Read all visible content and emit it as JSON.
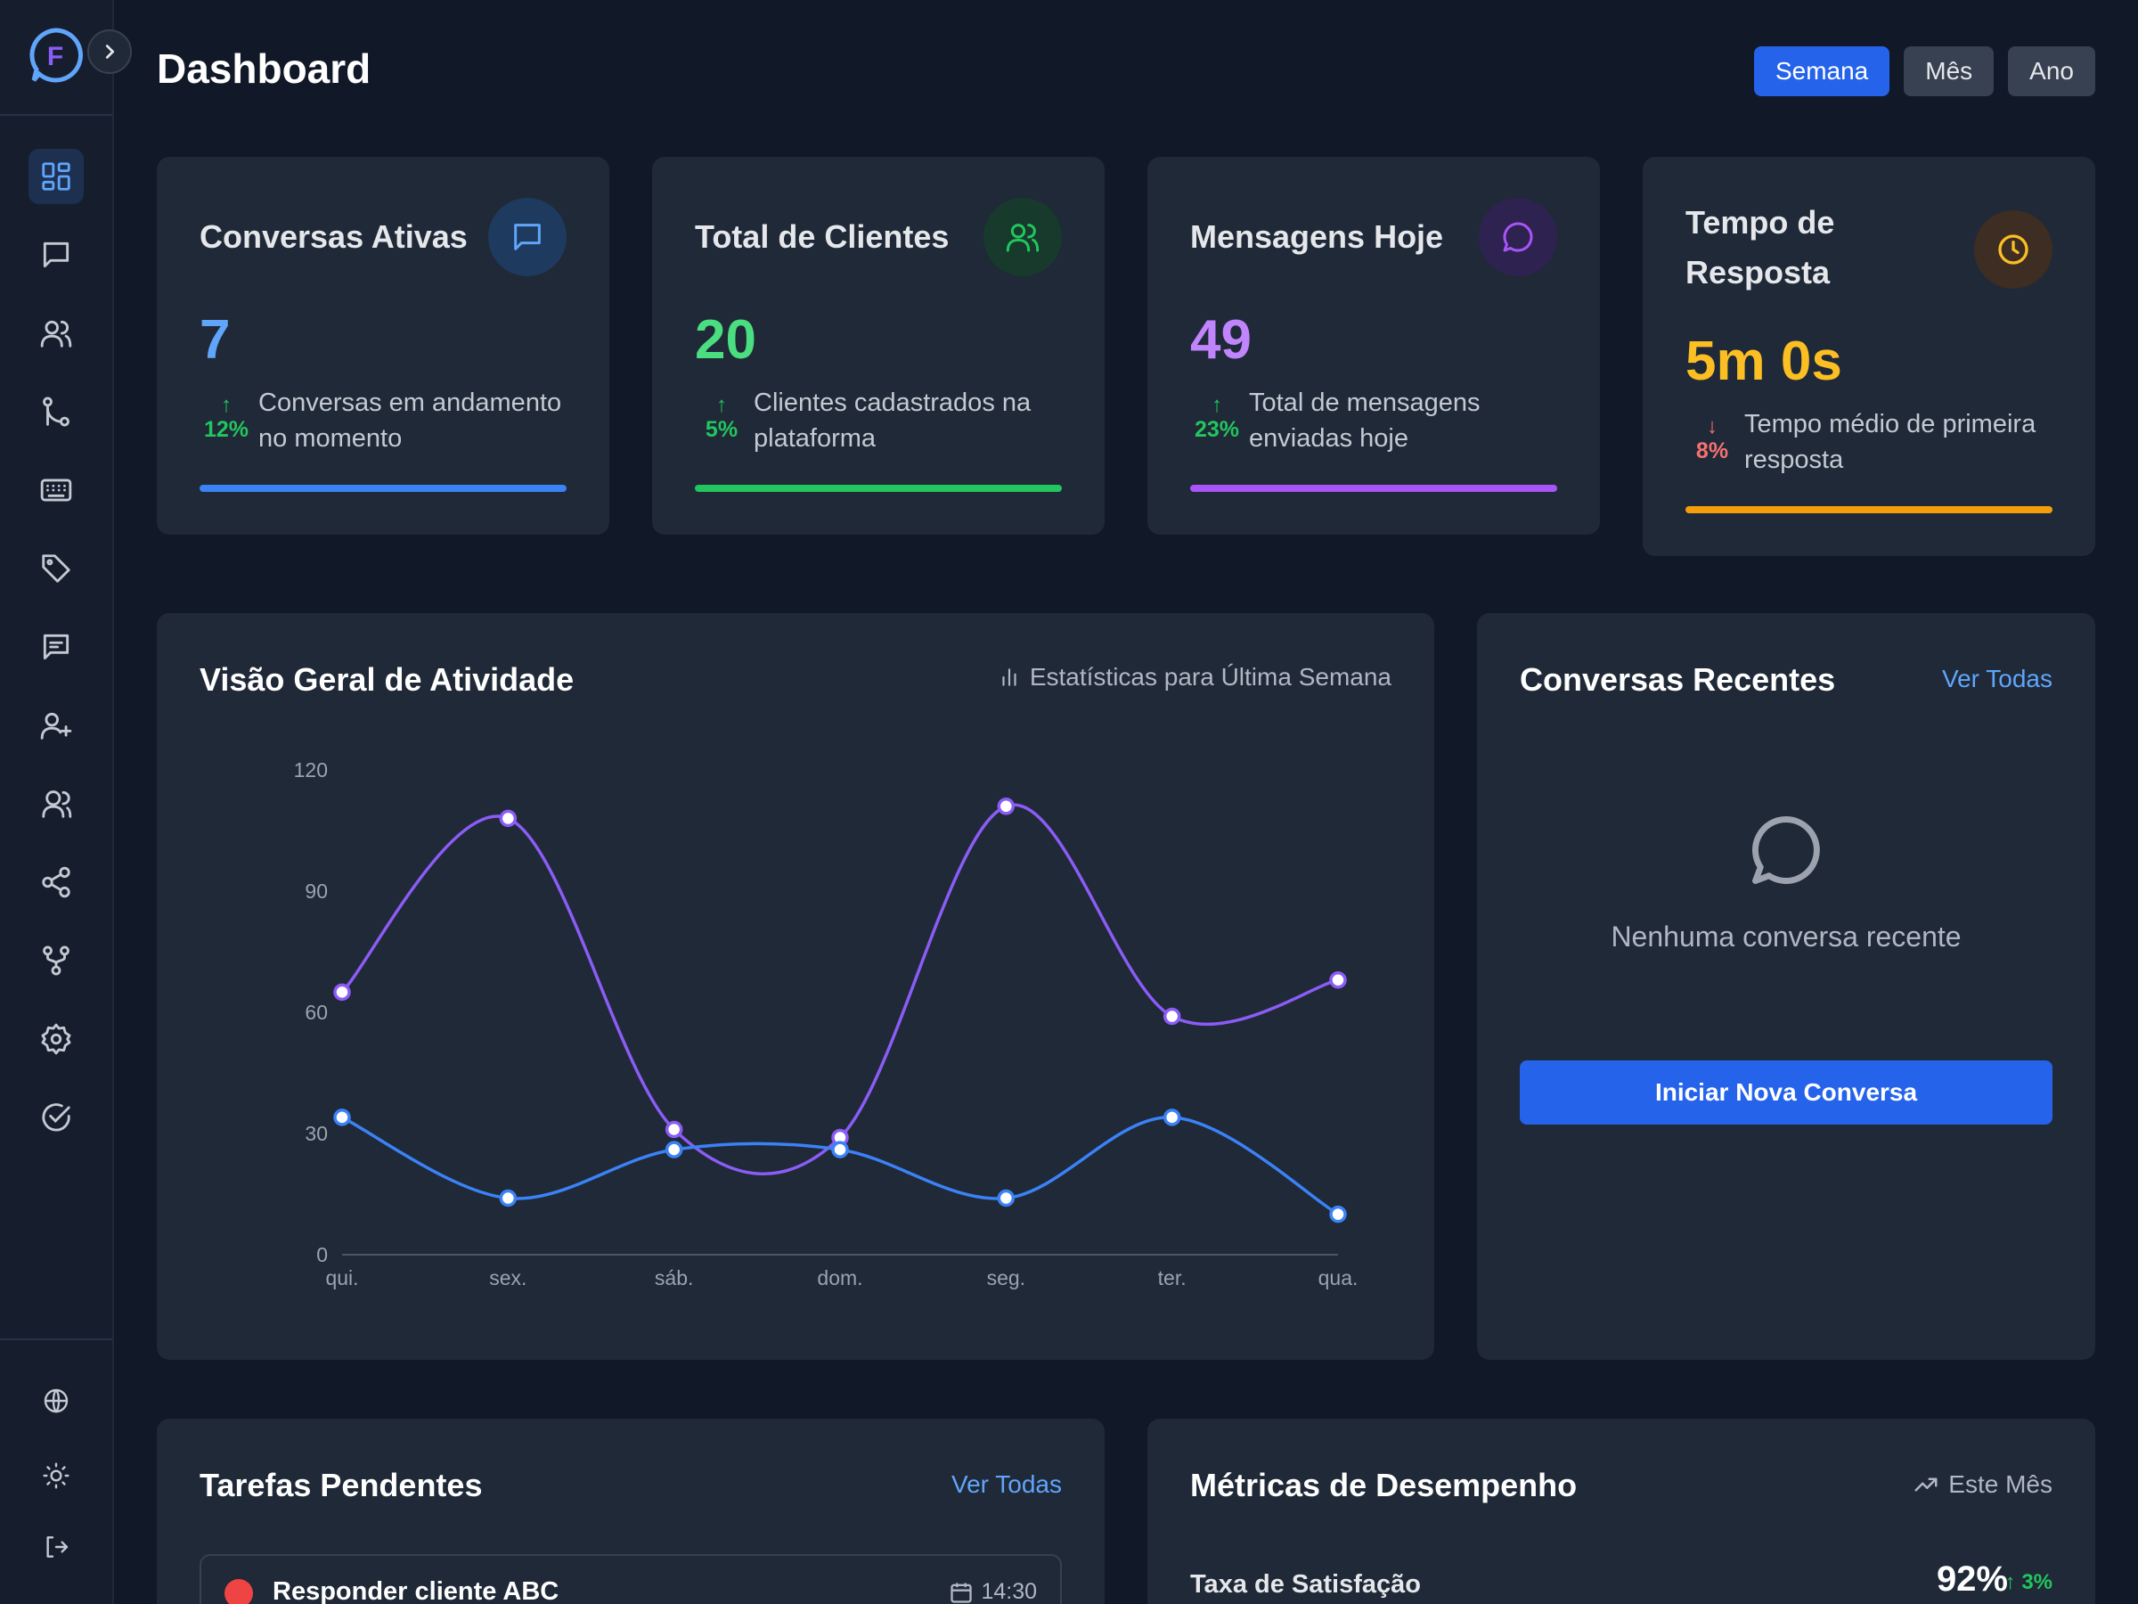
{
  "app": {
    "logo_letter": "F"
  },
  "header": {
    "title": "Dashboard",
    "periods": [
      "Semana",
      "Mês",
      "Ano"
    ],
    "active_period": "Semana"
  },
  "sidebar": {
    "nav_items": [
      {
        "icon": "dashboard-icon",
        "active": true
      },
      {
        "icon": "chat-icon",
        "active": false
      },
      {
        "icon": "users-icon",
        "active": false
      },
      {
        "icon": "branch-icon",
        "active": false
      },
      {
        "icon": "keyboard-icon",
        "active": false
      },
      {
        "icon": "tag-icon",
        "active": false
      },
      {
        "icon": "message-lines-icon",
        "active": false
      },
      {
        "icon": "user-plus-icon",
        "active": false
      },
      {
        "icon": "team-icon",
        "active": false
      },
      {
        "icon": "share-icon",
        "active": false
      },
      {
        "icon": "flow-icon",
        "active": false
      },
      {
        "icon": "gear-icon",
        "active": false
      },
      {
        "icon": "check-circle-icon",
        "active": false
      }
    ],
    "bottom_items": [
      {
        "icon": "globe-icon"
      },
      {
        "icon": "sun-icon"
      },
      {
        "icon": "logout-icon"
      }
    ]
  },
  "stats": [
    {
      "title": "Conversas Ativas",
      "value": "7",
      "change": "12%",
      "direction": "up",
      "description": "Conversas em andamento no momento",
      "color": "#3b82f6",
      "icon": "chat-icon"
    },
    {
      "title": "Total de Clientes",
      "value": "20",
      "change": "5%",
      "direction": "up",
      "description": "Clientes cadastrados na plataforma",
      "color": "#22c55e",
      "icon": "users-icon"
    },
    {
      "title": "Mensagens Hoje",
      "value": "49",
      "change": "23%",
      "direction": "up",
      "description": "Total de mensagens enviadas hoje",
      "color": "#a855f7",
      "icon": "message-circle-icon"
    },
    {
      "title": "Tempo de Resposta",
      "value": "5m 0s",
      "change": "8%",
      "direction": "down",
      "description": "Tempo médio de primeira resposta",
      "color": "#fbbf24",
      "icon": "clock-icon"
    }
  ],
  "activity": {
    "title": "Visão Geral de Atividade",
    "meta": "Estatísticas para Última Semana"
  },
  "chart_data": {
    "type": "line",
    "categories": [
      "qui.",
      "sex.",
      "sáb.",
      "dom.",
      "seg.",
      "ter.",
      "qua."
    ],
    "series": [
      {
        "values": [
          65,
          108,
          31,
          29,
          111,
          59,
          68
        ],
        "color": "#8b5cf6"
      },
      {
        "values": [
          34,
          14,
          26,
          26,
          14,
          34,
          10
        ],
        "color": "#3b82f6"
      }
    ],
    "yticks": [
      0,
      30,
      60,
      90,
      120
    ],
    "ylim": [
      0,
      120
    ]
  },
  "recent": {
    "title": "Conversas Recentes",
    "link": "Ver Todas",
    "empty_text": "Nenhuma conversa recente",
    "button": "Iniciar Nova Conversa"
  },
  "tasks": {
    "title": "Tarefas Pendentes",
    "link": "Ver Todas",
    "items": [
      {
        "text": "Responder cliente ABC",
        "time": "14:30",
        "priority_color": "#ef4444"
      }
    ]
  },
  "metrics": {
    "title": "Métricas de Desempenho",
    "period": "Este Mês",
    "items": [
      {
        "label": "Taxa de Satisfação",
        "value": "92%",
        "change": "3%",
        "direction": "up"
      }
    ]
  }
}
